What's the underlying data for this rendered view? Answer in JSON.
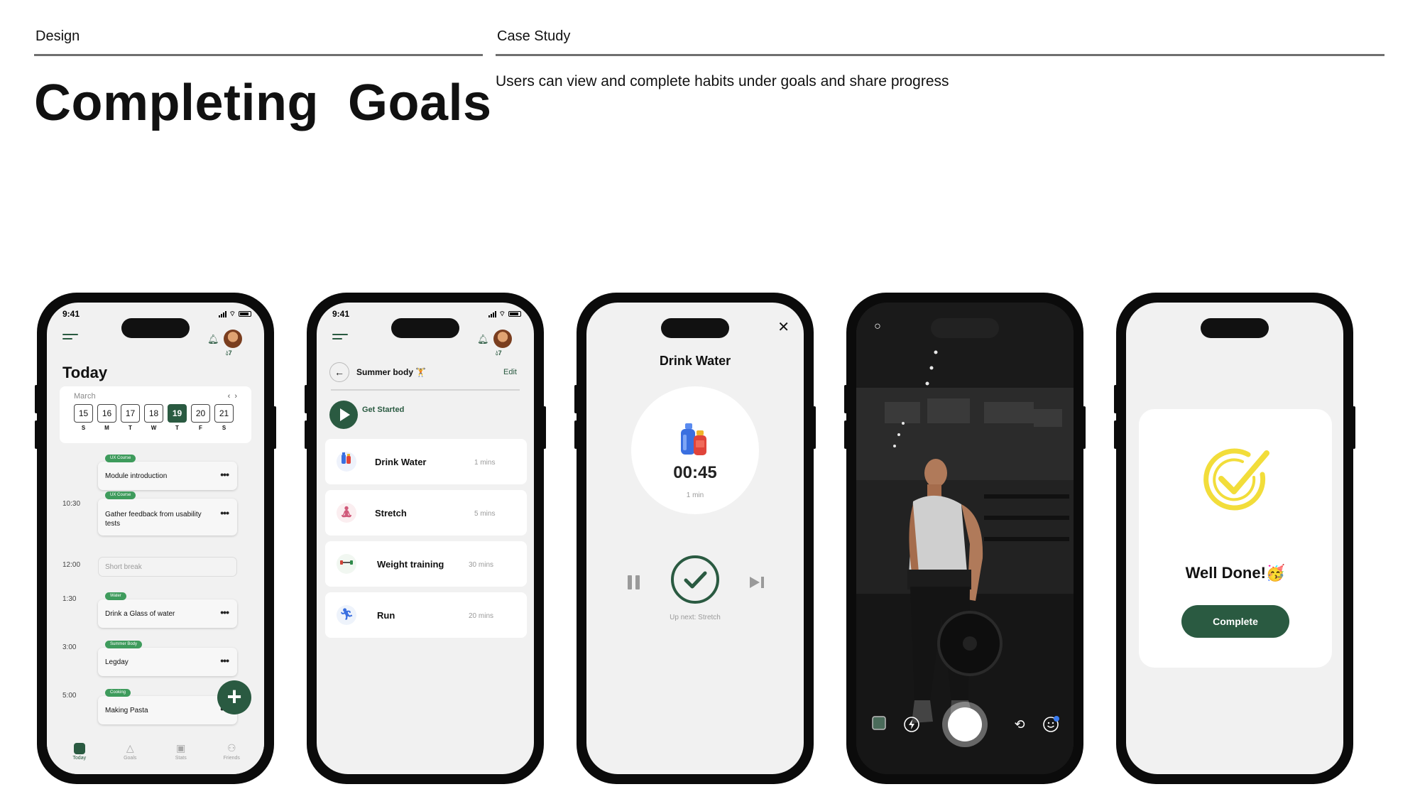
{
  "header": {
    "left_label": "Design",
    "right_label": "Case Study",
    "title": "Completing  Goals",
    "subtitle": "Users can view and complete habits under goals and share progress"
  },
  "status": {
    "time": "9:41"
  },
  "profile": {
    "streak": "7"
  },
  "today_screen": {
    "title": "Today",
    "month": "March",
    "days": [
      {
        "num": "15",
        "dow": "S"
      },
      {
        "num": "16",
        "dow": "M"
      },
      {
        "num": "17",
        "dow": "T"
      },
      {
        "num": "18",
        "dow": "W"
      },
      {
        "num": "19",
        "dow": "T"
      },
      {
        "num": "20",
        "dow": "F"
      },
      {
        "num": "21",
        "dow": "S"
      }
    ],
    "selected_day": "19",
    "tasks": [
      {
        "time": "",
        "tag": "UX Course",
        "title": "Module introduction"
      },
      {
        "time": "10:30",
        "tag": "UX Course",
        "title": "Gather feedback from usability tests"
      },
      {
        "time": "12:00",
        "tag": "",
        "title": "Short break"
      },
      {
        "time": "1:30",
        "tag": "Water",
        "title": "Drink a Glass of water"
      },
      {
        "time": "3:00",
        "tag": "Summer Body",
        "title": "Legday"
      },
      {
        "time": "5:00",
        "tag": "Cooking",
        "title": "Making Pasta"
      }
    ],
    "tabs": [
      "Today",
      "Goals",
      "Stats",
      "Friends"
    ]
  },
  "goal_screen": {
    "goal_name": "Summer body 🏋",
    "edit_label": "Edit",
    "get_started": "Get Started",
    "habits": [
      {
        "name": "Drink Water",
        "duration": "1 mins",
        "icon": "water-bottle-icon"
      },
      {
        "name": "Stretch",
        "duration": "5 mins",
        "icon": "stretch-icon"
      },
      {
        "name": "Weight training",
        "duration": "30 mins",
        "icon": "dumbbell-icon"
      },
      {
        "name": "Run",
        "duration": "20 mins",
        "icon": "run-icon"
      }
    ]
  },
  "timer_screen": {
    "title": "Drink Water",
    "timer": "00:45",
    "timer_sub": "1 min",
    "up_next": "Up next: Stretch"
  },
  "done_screen": {
    "title": "Well Done!🥳",
    "button": "Complete"
  },
  "colors": {
    "brand_green": "#2a5a41",
    "tag_green": "#3e9b5c",
    "success_yellow": "#f2dd3a"
  }
}
